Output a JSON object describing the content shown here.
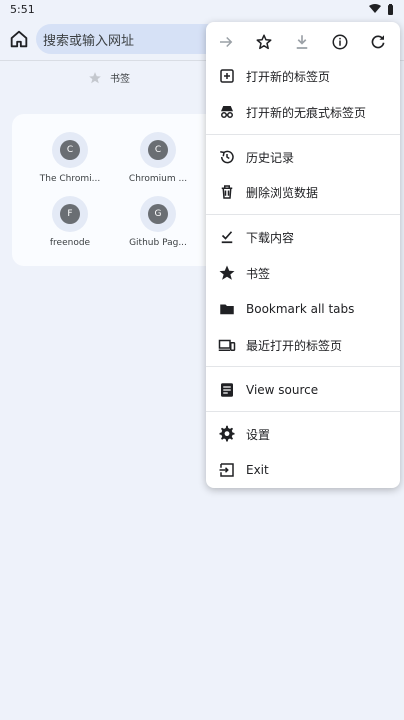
{
  "status_bar": {
    "time": "5:51"
  },
  "toolbar": {
    "omnibox_placeholder": "搜索或输入网址"
  },
  "bookmarks_label": "书签",
  "tiles": [
    {
      "letter": "C",
      "label": "The Chromi..."
    },
    {
      "letter": "C",
      "label": "Chromium ..."
    },
    {
      "letter": "F",
      "label": "freenode"
    },
    {
      "letter": "G",
      "label": "Github Pag..."
    }
  ],
  "menu": {
    "items": [
      {
        "label": "打开新的标签页",
        "icon": "new-tab-icon"
      },
      {
        "label": "打开新的无痕式标签页",
        "icon": "incognito-icon"
      },
      {
        "label": "历史记录",
        "icon": "history-icon"
      },
      {
        "label": "删除浏览数据",
        "icon": "trash-icon"
      },
      {
        "label": "下载内容",
        "icon": "downloads-icon"
      },
      {
        "label": "书签",
        "icon": "star-icon"
      },
      {
        "label": "Bookmark all tabs",
        "icon": "folder-icon"
      },
      {
        "label": "最近打开的标签页",
        "icon": "devices-icon"
      },
      {
        "label": "View source",
        "icon": "source-icon"
      },
      {
        "label": "设置",
        "icon": "settings-icon"
      },
      {
        "label": "Exit",
        "icon": "exit-icon"
      }
    ]
  },
  "colors": {
    "background": "#eef2fa",
    "omnibox": "#d6e1f6",
    "menu": "#ffffff"
  }
}
